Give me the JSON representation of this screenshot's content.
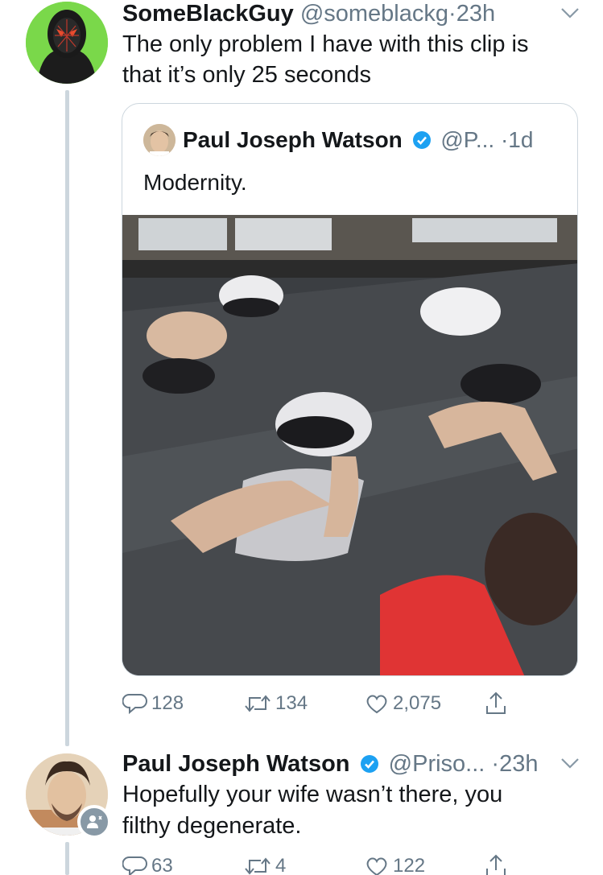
{
  "tweet1": {
    "name": "SomeBlackGuy",
    "handle": "@someblackg",
    "separator": "·",
    "time": "23h",
    "text_line1": "The only problem I have with this clip is",
    "text_line2": "that it’s only 25 seconds",
    "quote": {
      "name": "Paul Joseph Watson",
      "handle": "@P...",
      "separator": "·",
      "time": "1d",
      "text": "Modernity."
    },
    "stats": {
      "replies": "128",
      "retweets": "134",
      "likes": "2,075"
    }
  },
  "tweet2": {
    "name": "Paul Joseph Watson",
    "handle": "@Priso...",
    "separator": "·",
    "time": "23h",
    "text_line1": "Hopefully your wife wasn’t there, you",
    "text_line2": "filthy degenerate.",
    "stats": {
      "replies": "63",
      "retweets": "4",
      "likes": "122"
    }
  },
  "colors": {
    "verified": "#1da1f2",
    "secondary": "#657786",
    "line": "#ccd6dd",
    "avatar_bg": "#7ad84a"
  },
  "icons": [
    "reply-icon",
    "retweet-icon",
    "like-icon",
    "share-icon",
    "verified-icon",
    "chevron-down-icon"
  ]
}
